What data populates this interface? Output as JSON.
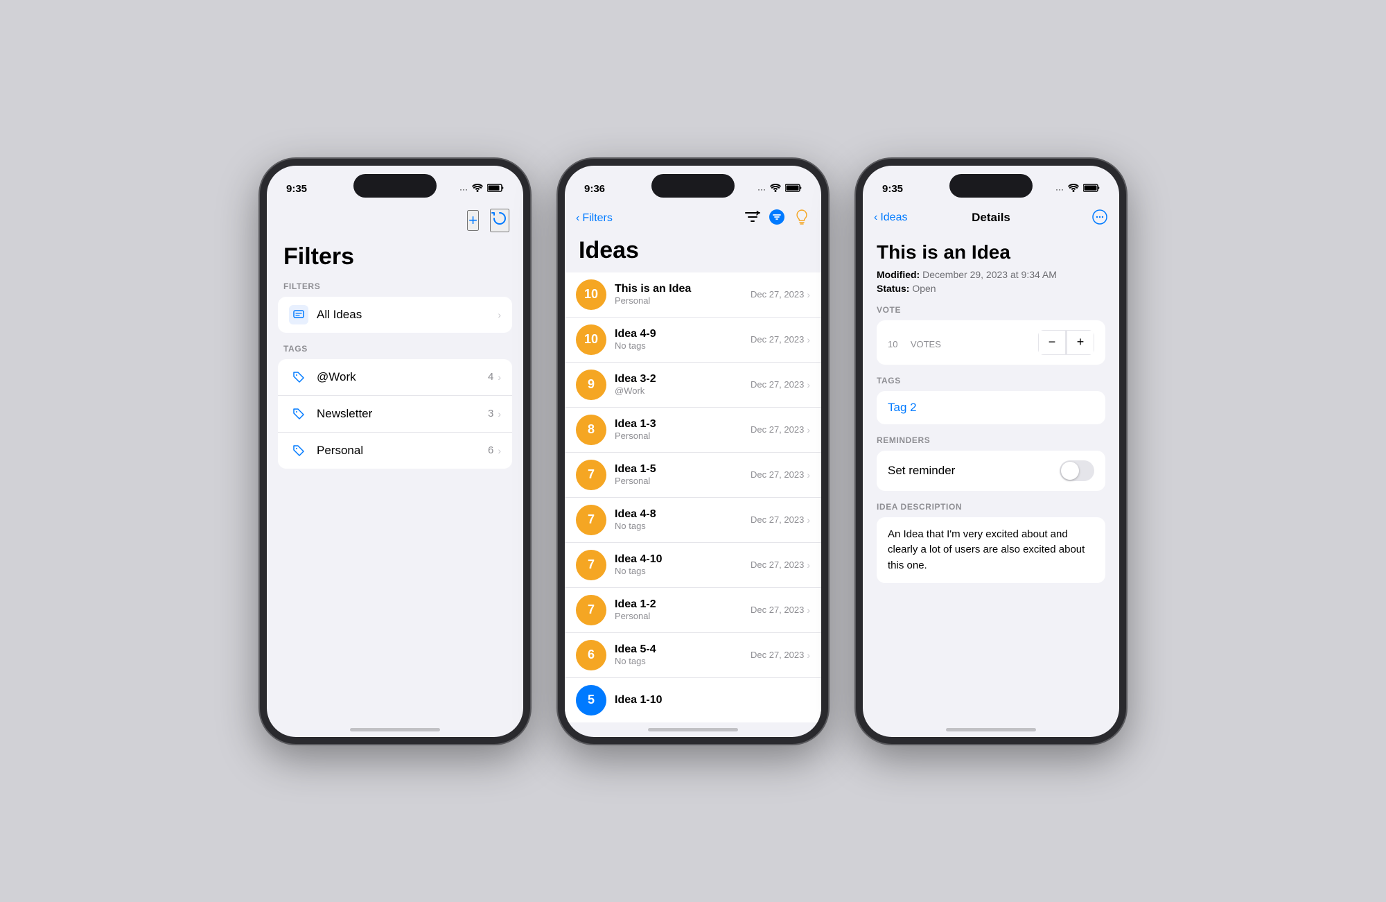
{
  "phone1": {
    "time": "9:35",
    "title": "Filters",
    "filters_label": "FILTERS",
    "tags_label": "TAGS",
    "add_icon": "+",
    "refresh_icon": "⟳",
    "all_ideas": {
      "label": "All Ideas"
    },
    "tags": [
      {
        "label": "@Work",
        "count": "4"
      },
      {
        "label": "Newsletter",
        "count": "3"
      },
      {
        "label": "Personal",
        "count": "6"
      }
    ]
  },
  "phone2": {
    "time": "9:36",
    "back_label": "Filters",
    "title": "Ideas",
    "ideas": [
      {
        "votes": "10",
        "name": "This is an Idea",
        "sub": "Personal",
        "date": "Dec 27, 2023"
      },
      {
        "votes": "10",
        "name": "Idea 4-9",
        "sub": "No tags",
        "date": "Dec 27, 2023"
      },
      {
        "votes": "9",
        "name": "Idea 3-2",
        "sub": "@Work",
        "date": "Dec 27, 2023"
      },
      {
        "votes": "8",
        "name": "Idea 1-3",
        "sub": "Personal",
        "date": "Dec 27, 2023"
      },
      {
        "votes": "7",
        "name": "Idea 1-5",
        "sub": "Personal",
        "date": "Dec 27, 2023"
      },
      {
        "votes": "7",
        "name": "Idea 4-8",
        "sub": "No tags",
        "date": "Dec 27, 2023"
      },
      {
        "votes": "7",
        "name": "Idea 4-10",
        "sub": "No tags",
        "date": "Dec 27, 2023"
      },
      {
        "votes": "7",
        "name": "Idea 1-2",
        "sub": "Personal",
        "date": "Dec 27, 2023"
      },
      {
        "votes": "6",
        "name": "Idea 5-4",
        "sub": "No tags",
        "date": "Dec 27, 2023"
      },
      {
        "votes": "5",
        "name": "Idea 1-10",
        "sub": "",
        "date": ""
      }
    ]
  },
  "phone3": {
    "time": "9:35",
    "back_label": "Ideas",
    "nav_title": "Details",
    "idea_title": "This is an Idea",
    "modified_label": "Modified:",
    "modified_value": "December 29, 2023 at 9:34 AM",
    "status_label": "Status:",
    "status_value": "Open",
    "vote_section": "VOTE",
    "vote_count": "10",
    "vote_unit": "VOTES",
    "tags_section": "TAGS",
    "tag_value": "Tag 2",
    "reminders_section": "REMINDERS",
    "reminder_label": "Set reminder",
    "description_section": "IDEA DESCRIPTION",
    "description_text": "An Idea that I'm very excited about and clearly a lot of users are also excited about this one."
  },
  "status": {
    "signal": "···",
    "wifi": "wifi",
    "battery": "battery"
  }
}
